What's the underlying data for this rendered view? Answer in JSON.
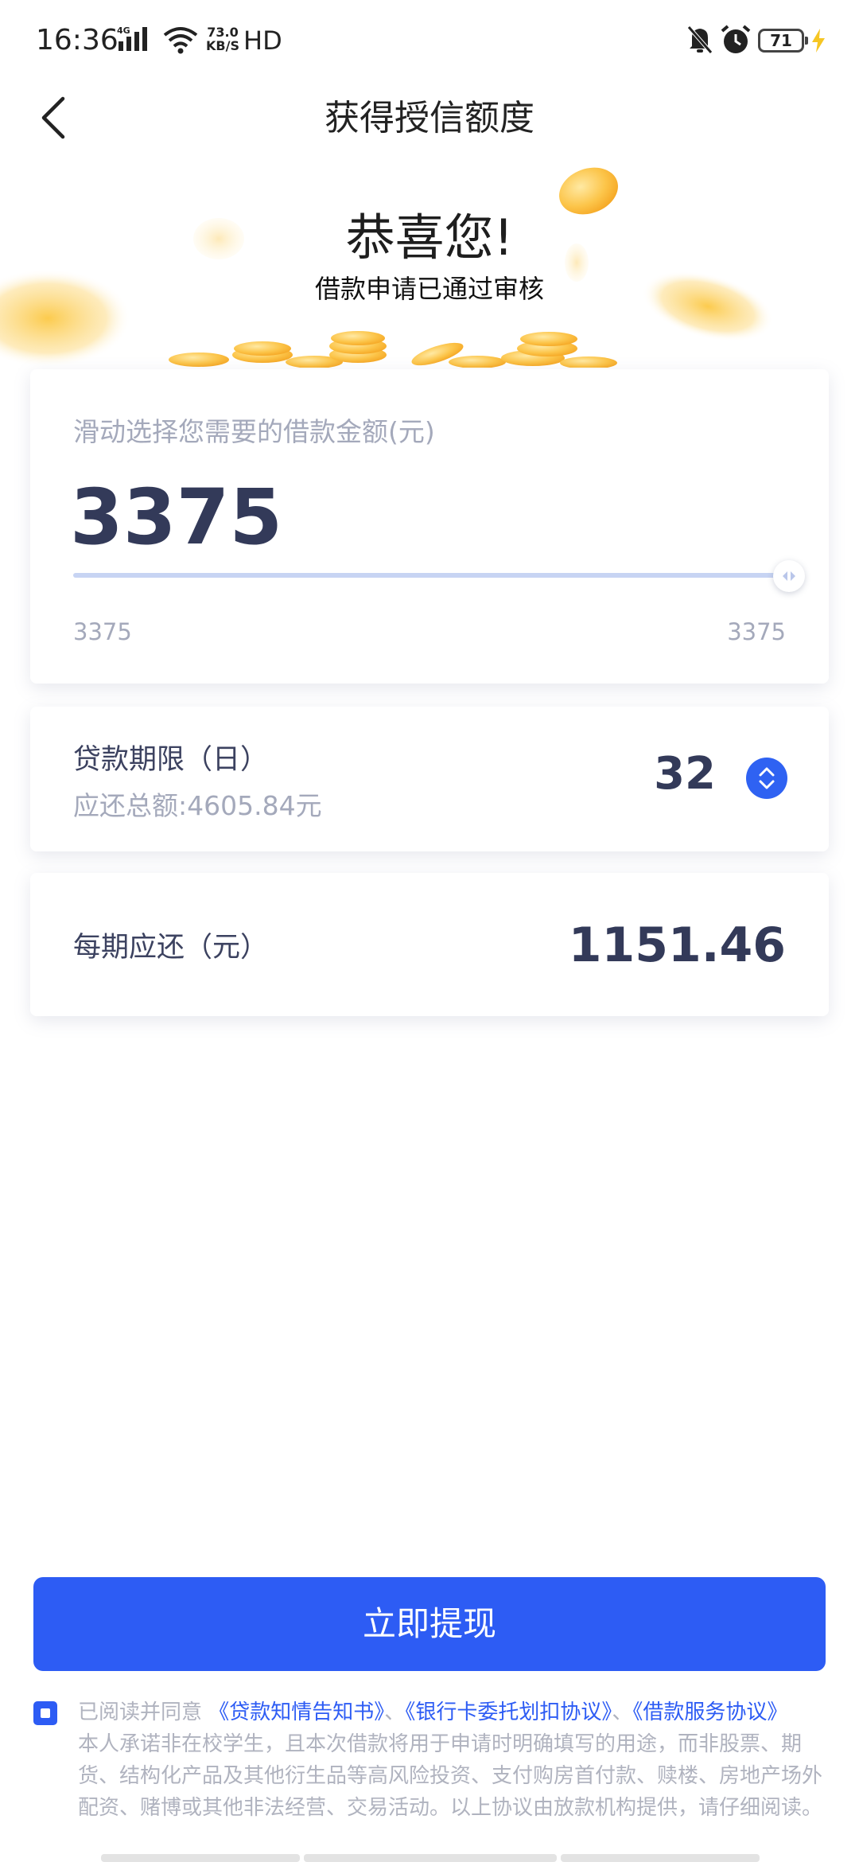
{
  "status_bar": {
    "time": "16:36",
    "network": "4G",
    "speed_value": "73.0",
    "speed_unit": "KB/S",
    "hd": "HD",
    "battery": "71"
  },
  "nav": {
    "title": "获得授信额度",
    "back_icon": "chevron-left-icon"
  },
  "hero": {
    "title": "恭喜您!",
    "subtitle": "借款申请已通过审核"
  },
  "amount_card": {
    "label": "滑动选择您需要的借款金额(元)",
    "value": "3375",
    "slider": {
      "min_label": "3375",
      "max_label": "3375",
      "position": 1.0
    }
  },
  "term_card": {
    "label": "贷款期限（日）",
    "total": "应还总额:4605.84元",
    "value": "32",
    "stepper_icon": "up-down-chevron-icon"
  },
  "period_card": {
    "label": "每期应还（元）",
    "value": "1151.46"
  },
  "withdraw_button": {
    "label": "立即提现"
  },
  "agreement": {
    "checked": true,
    "prefix": "已阅读并同意",
    "link1": "《贷款知情告知书》",
    "sep1": "、",
    "link2": "《银行卡委托划扣协议》",
    "sep2": "、",
    "link3": "《借款服务协议》",
    "body": "本人承诺非在校学生，且本次借款将用于申请时明确填写的用途，而非股票、期货、结构化产品及其他衍生品等高风险投资、支付购房首付款、赎楼、房地产场外配资、赌博或其他非法经营、交易活动。以上协议由放款机构提供，请仔细阅读。"
  },
  "colors": {
    "primary": "#2d5cf4",
    "text_dark": "#333a59",
    "text_muted": "#a4a9bb",
    "coin": "#fcc54a"
  }
}
